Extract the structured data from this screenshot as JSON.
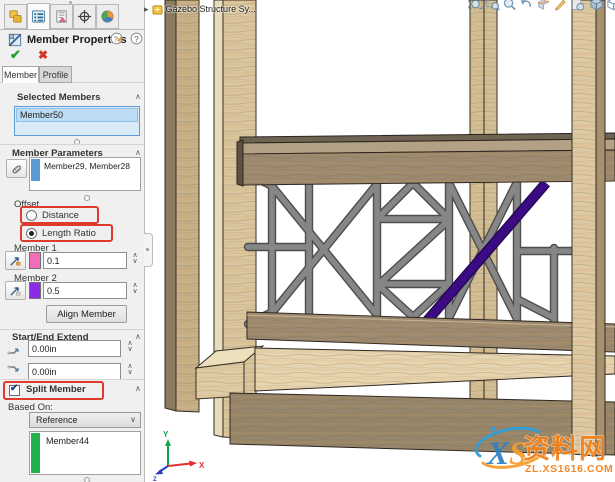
{
  "panel": {
    "tab_icons": [
      "feature-manager-icon",
      "property-manager-icon",
      "configuration-manager-icon",
      "dimxpert-icon",
      "display-manager-icon"
    ],
    "title": "Member Properties",
    "ok_glyph": "✔",
    "cancel_glyph": "✖",
    "sub_tabs": {
      "member": "Member",
      "profile": "Profile"
    },
    "selected_members": {
      "title": "Selected Members",
      "item0": "Member50"
    },
    "member_parameters": {
      "title": "Member Parameters",
      "value": "Member29, Member28",
      "bar_color": "#5b9bd5"
    },
    "offset": {
      "label": "Offset",
      "distance_label": "Distance",
      "length_ratio_label": "Length Ratio",
      "selected": "Length Ratio"
    },
    "member1": {
      "label": "Member 1",
      "value": "0.1",
      "swatch_color": "#f26cb8"
    },
    "member2": {
      "label": "Member 2",
      "value": "0.5",
      "swatch_color": "#8d2ae8"
    },
    "align_button_label": "Align Member",
    "start_end_extend": {
      "title": "Start/End Extend",
      "field1": "0.00in",
      "field2": "0.00in"
    },
    "split_member": {
      "label": "Split Member",
      "checked": true,
      "based_on_label": "Based On:",
      "dropdown_value": "Reference",
      "item0": "Member44",
      "bar_color": "#22b14c"
    },
    "annotation_color": "#e03a2f"
  },
  "viewport": {
    "tree_item": "Gazebo Structure Sy...",
    "toolbar_icons": [
      "zoom-fit-icon",
      "zoom-area-icon",
      "magnifier-icon",
      "previous-view-icon",
      "section-view-icon",
      "sketch-icon",
      "appearance-icon",
      "view-cube-icon",
      "display-style-icon"
    ],
    "triad": {
      "x_label": "X",
      "y_label": "Y",
      "z_label": "Z"
    },
    "colors": {
      "purple_member": "#3a0b82",
      "wood_light": "#d8c59e",
      "rail_brown": "#9c8a71",
      "metal_gray": "#7c7c7c"
    }
  },
  "watermark": {
    "logo_x": "X",
    "logo_s": "S",
    "site_name": "资料网",
    "url": "ZL.XS1616.COM"
  }
}
